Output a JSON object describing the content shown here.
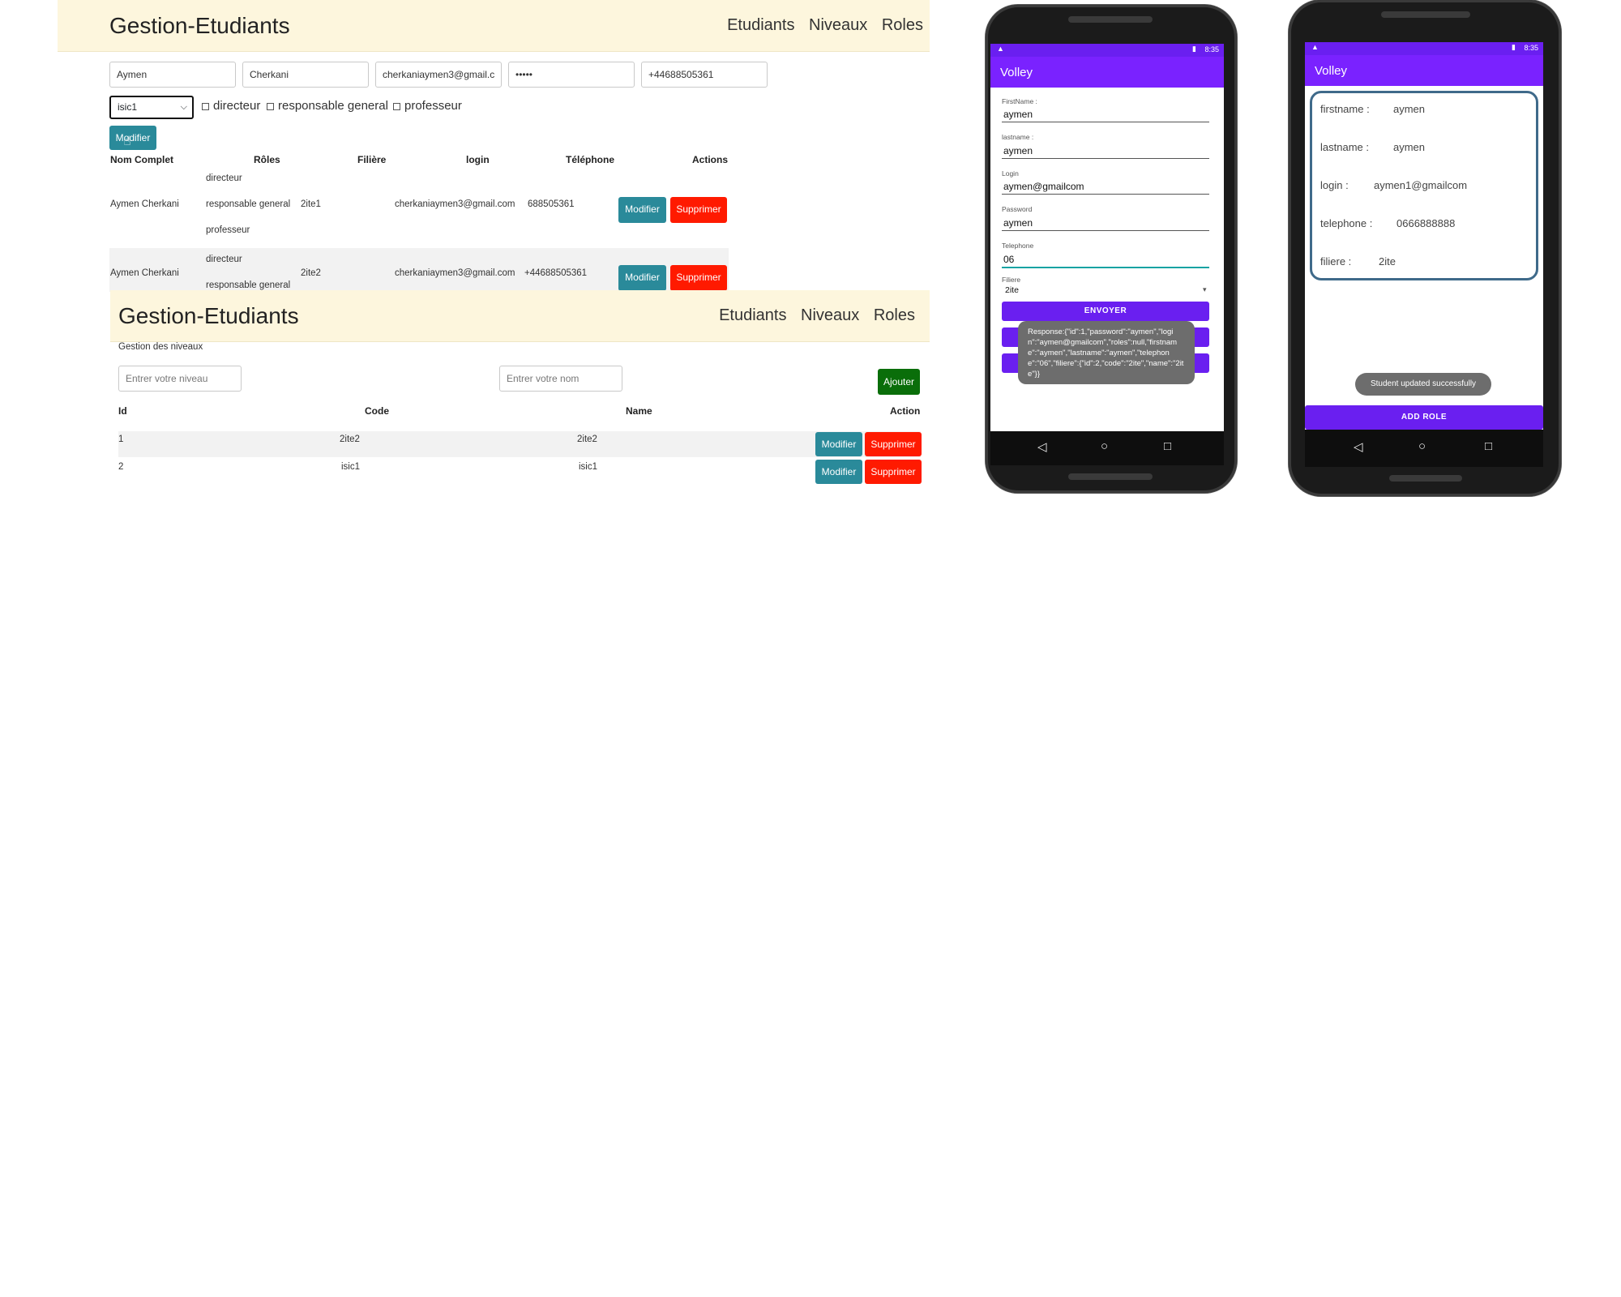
{
  "web1": {
    "brand": "Gestion-Etudiants",
    "nav": [
      "Etudiants",
      "Niveaux",
      "Roles"
    ],
    "form": {
      "firstname": "Aymen",
      "lastname": "Cherkani",
      "email": "cherkaniaymen3@gmail.c",
      "password": "•••••",
      "telephone": "+44688505361",
      "filiere_selected": "isic1",
      "checkboxes": [
        "directeur",
        "responsable general",
        "professeur"
      ],
      "submit_label": "Modifier"
    },
    "table": {
      "headers": [
        "Nom Complet",
        "Rôles",
        "Filière",
        "login",
        "Téléphone",
        "Actions"
      ],
      "rows": [
        {
          "name": "Aymen Cherkani",
          "roles": [
            "directeur",
            "responsable general",
            "professeur"
          ],
          "filiere": "2ite1",
          "login": "cherkaniaymen3@gmail.com",
          "telephone": "688505361",
          "edit": "Modifier",
          "delete": "Supprimer"
        },
        {
          "name": "Aymen Cherkani",
          "roles": [
            "directeur",
            "responsable general"
          ],
          "filiere": "2ite2",
          "login": "cherkaniaymen3@gmail.com",
          "telephone": "+44688505361",
          "edit": "Modifier",
          "delete": "Supprimer"
        }
      ]
    }
  },
  "web2": {
    "brand": "Gestion-Etudiants",
    "nav": [
      "Etudiants",
      "Niveaux",
      "Roles"
    ],
    "section_title": "Gestion des niveaux",
    "niveau_placeholder": "Entrer votre niveau",
    "nom_placeholder": "Entrer votre nom",
    "add_label": "Ajouter",
    "headers": [
      "Id",
      "Code",
      "Name",
      "Action"
    ],
    "rows": [
      {
        "id": "1",
        "code": "2ite2",
        "name": "2ite2",
        "edit": "Modifier",
        "delete": "Supprimer"
      },
      {
        "id": "2",
        "code": "isic1",
        "name": "isic1",
        "edit": "Modifier",
        "delete": "Supprimer"
      }
    ]
  },
  "phone1": {
    "time": "8:35",
    "app_title": "Volley",
    "fields": [
      {
        "label": "FirstName :",
        "value": "aymen"
      },
      {
        "label": "lastname :",
        "value": "aymen"
      },
      {
        "label": "Login",
        "value": "aymen@gmailcom"
      },
      {
        "label": "Password",
        "value": "aymen"
      },
      {
        "label": "Telephone",
        "value": "06"
      }
    ],
    "filiere_label": "Filiere",
    "filiere_value": "2ite",
    "send_label": "ENVOYER",
    "toast": "Response:{\"id\":1,\"password\":\"aymen\",\"login\":\"aymen@gmailcom\",\"roles\":null,\"firstname\":\"aymen\",\"lastname\":\"aymen\",\"telephone\":\"06\",\"filiere\":{\"id\":2,\"code\":\"2ite\",\"name\":\"2ite\"}}"
  },
  "phone2": {
    "time": "8:35",
    "app_title": "Volley",
    "details": [
      {
        "label": "firstname :",
        "value": "aymen"
      },
      {
        "label": "lastname :",
        "value": "aymen"
      },
      {
        "label": "login :",
        "value": "aymen1@gmailcom"
      },
      {
        "label": "telephone :",
        "value": "0666888888"
      },
      {
        "label": "filiere :",
        "value": "2ite"
      }
    ],
    "toast": "Student updated successfully",
    "add_role_label": "ADD ROLE"
  },
  "colors": {
    "navbar_bg": "#fdf6dd",
    "teal_button": "#2a8a9a",
    "red_button": "#ff1a00",
    "green_button": "#0a6e0a",
    "android_primary": "#7a22ff"
  }
}
